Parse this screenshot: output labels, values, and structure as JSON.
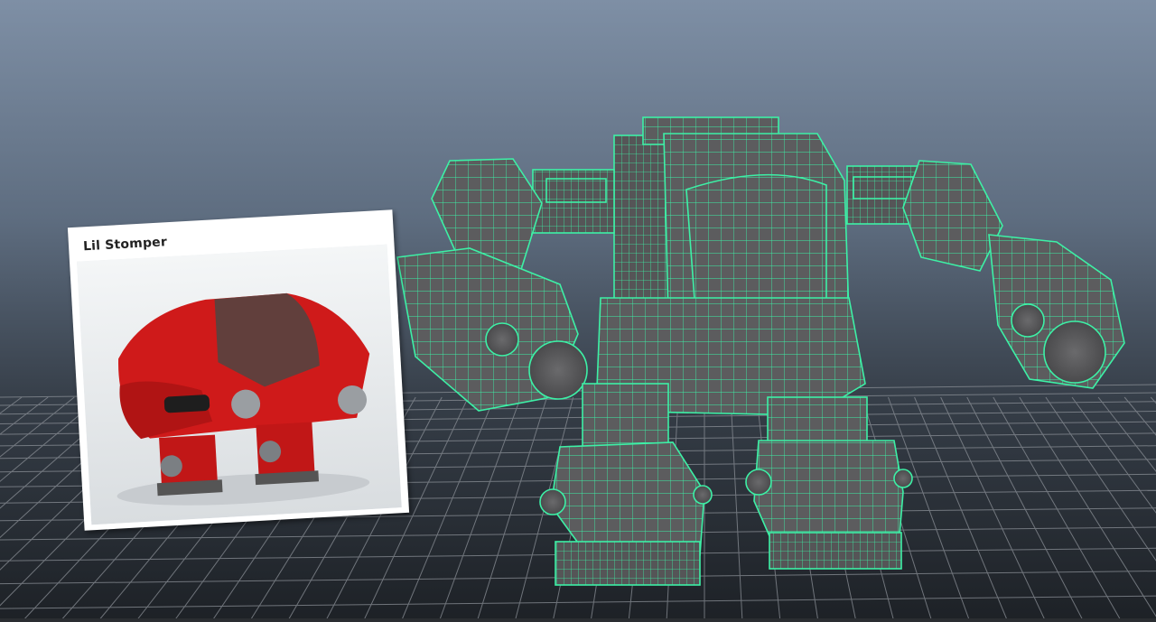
{
  "reference_card": {
    "title": "Lil Stomper"
  },
  "viewport": {
    "background_top": "#7e8fa5",
    "background_bottom": "#1d2126",
    "wireframe_color": "#3df0a6",
    "mesh_face_color": "#5c5c5e",
    "grid_color": "#8a8f96"
  }
}
